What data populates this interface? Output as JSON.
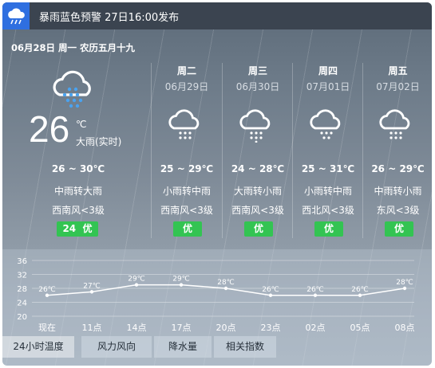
{
  "alert": {
    "text": "暴雨蓝色预警 27日16:00发布",
    "icon": "storm-cloud-icon"
  },
  "today_header": "06月28日 周一 农历五月十九",
  "current": {
    "temp": "26",
    "unit": "℃",
    "desc": "大雨(实时)",
    "range": "26 ~ 30℃",
    "weather": "中雨转大雨",
    "wind": "西南风<3级",
    "aqi_value": "24",
    "aqi_label": "优",
    "icon": "heavy-rain-cloud-icon"
  },
  "forecast": [
    {
      "day": "周二",
      "date": "06月29日",
      "range": "25 ~ 29℃",
      "weather": "小雨转中雨",
      "wind": "西南风<3级",
      "aqi": "优",
      "icon": "rain-cloud-icon"
    },
    {
      "day": "周三",
      "date": "06月30日",
      "range": "24 ~ 28℃",
      "weather": "大雨转小雨",
      "wind": "西南风<3级",
      "aqi": "优",
      "icon": "rain-cloud-icon"
    },
    {
      "day": "周四",
      "date": "07月01日",
      "range": "25 ~ 31℃",
      "weather": "小雨转中雨",
      "wind": "西北风<3级",
      "aqi": "优",
      "icon": "rain-cloud-icon"
    },
    {
      "day": "周五",
      "date": "07月02日",
      "range": "26 ~ 29℃",
      "weather": "中雨转小雨",
      "wind": "东风<3级",
      "aqi": "优",
      "icon": "rain-cloud-icon"
    }
  ],
  "tabs": [
    "24小时温度",
    "风力风向",
    "降水量",
    "相关指数"
  ],
  "chart_data": {
    "type": "line",
    "categories": [
      "现在",
      "11点",
      "14点",
      "17点",
      "20点",
      "23点",
      "02点",
      "05点",
      "08点"
    ],
    "values": [
      26,
      27,
      29,
      29,
      28,
      26,
      26,
      26,
      28
    ],
    "data_labels": [
      "26℃",
      "27℃",
      "29℃",
      "29℃",
      "28℃",
      "26℃",
      "26℃",
      "26℃",
      "28℃"
    ],
    "yticks": [
      "20",
      "24",
      "28",
      "32",
      "36"
    ],
    "ylim": [
      20,
      36
    ],
    "grid": true
  }
}
